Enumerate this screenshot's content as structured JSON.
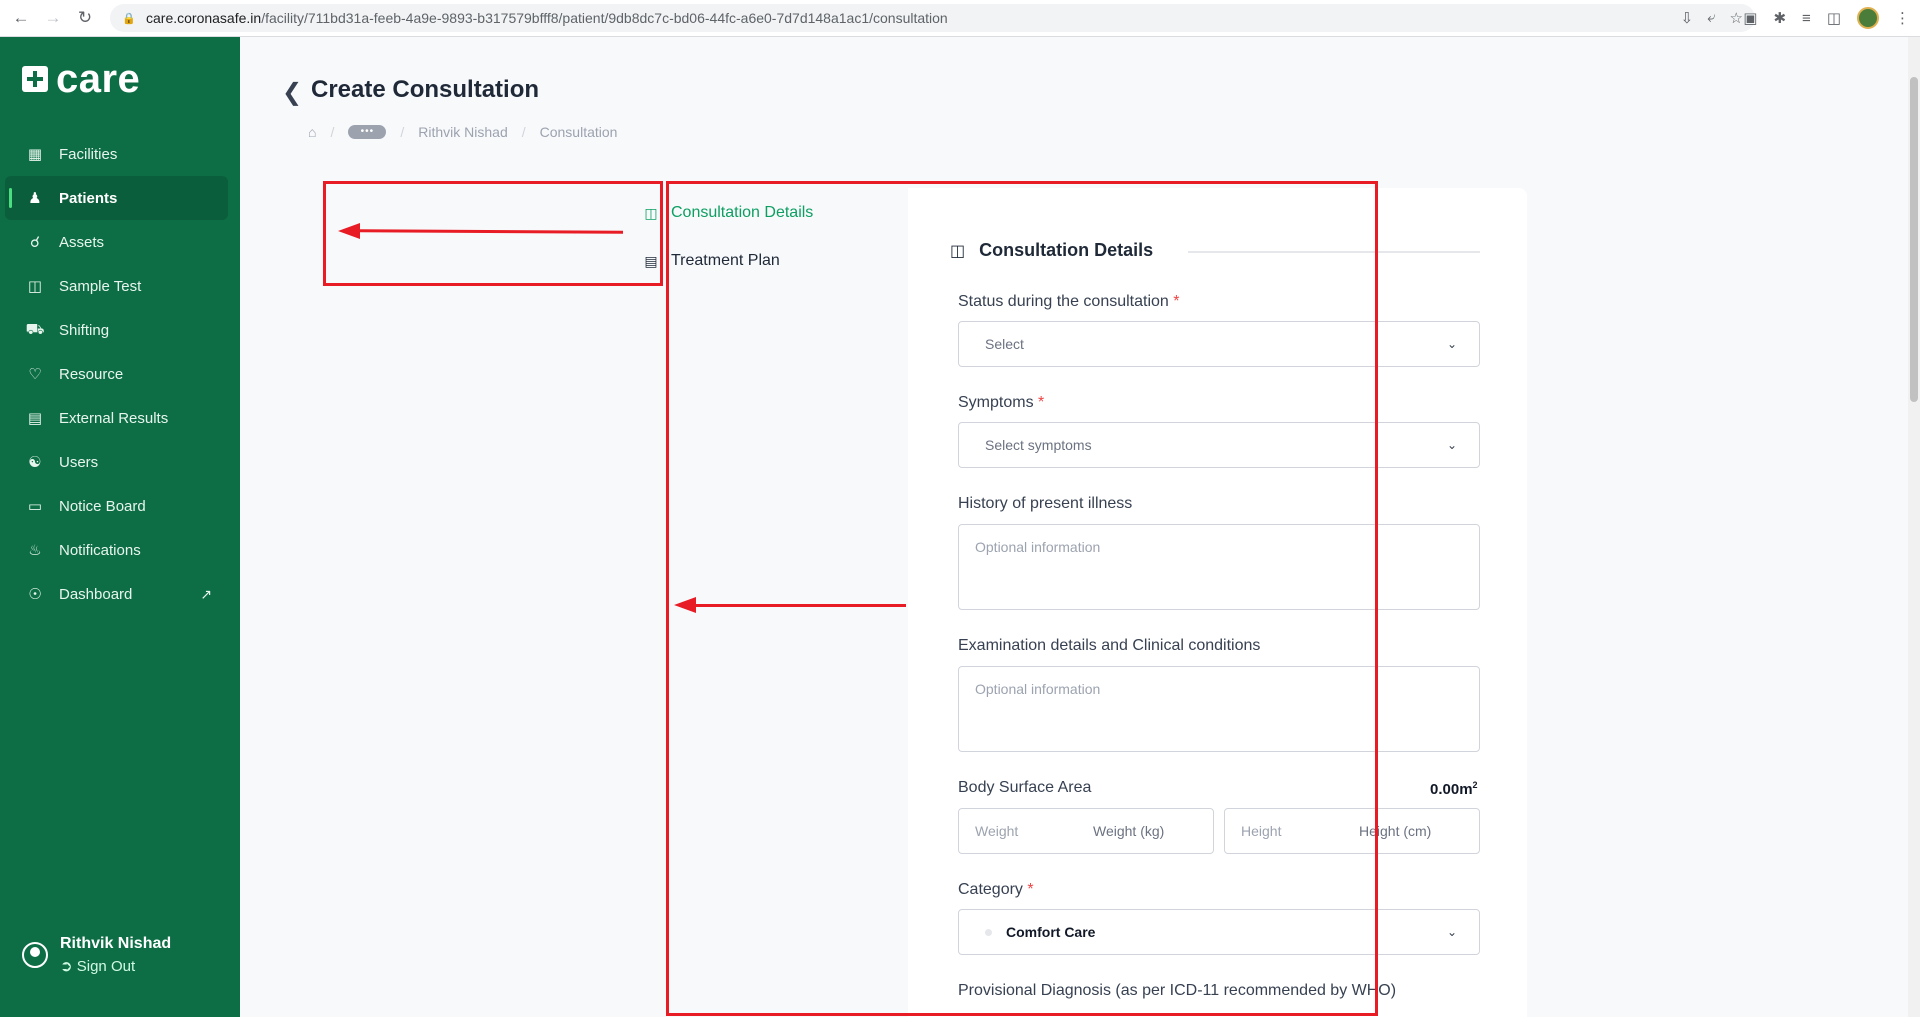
{
  "browser": {
    "url_host": "care.coronasafe.in",
    "url_path": "/facility/711bd31a-feeb-4a9e-9893-b317579bfff8/patient/9db8dc7c-bd06-44fc-a6e0-7d7d148a1ac1/consultation"
  },
  "sidebar": {
    "logo": "care",
    "items": [
      {
        "label": "Facilities",
        "icon": "building-icon"
      },
      {
        "label": "Patients",
        "icon": "user-icon"
      },
      {
        "label": "Assets",
        "icon": "cart-icon"
      },
      {
        "label": "Sample Test",
        "icon": "medkit-icon"
      },
      {
        "label": "Shifting",
        "icon": "ambulance-icon"
      },
      {
        "label": "Resource",
        "icon": "heart-icon"
      },
      {
        "label": "External Results",
        "icon": "clipboard-icon"
      },
      {
        "label": "Users",
        "icon": "users-icon"
      },
      {
        "label": "Notice Board",
        "icon": "monitor-icon"
      },
      {
        "label": "Notifications",
        "icon": "bell-icon"
      },
      {
        "label": "Dashboard",
        "icon": "dashboard-icon"
      }
    ],
    "active_item": "Patients",
    "user_name": "Rithvik Nishad",
    "sign_out": "Sign Out"
  },
  "header": {
    "title": "Create Consultation",
    "breadcrumb": [
      "Rithvik Nishad",
      "Consultation"
    ]
  },
  "tabs": {
    "consultation_details": "Consultation Details",
    "treatment_plan": "Treatment Plan"
  },
  "form": {
    "section_title": "Consultation Details",
    "status_label": "Status during the consultation",
    "status_placeholder": "Select",
    "symptoms_label": "Symptoms",
    "symptoms_placeholder": "Select symptoms",
    "history_label": "History of present illness",
    "history_placeholder": "Optional information",
    "exam_label": "Examination details and Clinical conditions",
    "exam_placeholder": "Optional information",
    "bsa_label": "Body Surface Area",
    "bsa_value": "0.00m",
    "bsa_unit_sup": "2",
    "weight_placeholder": "Weight",
    "weight_unit": "Weight (kg)",
    "height_placeholder": "Height",
    "height_unit": "Height (cm)",
    "category_label": "Category",
    "category_value": "Comfort Care",
    "diagnosis_label": "Provisional Diagnosis (as per ICD-11 recommended by WHO)",
    "required_mark": "*"
  },
  "colors": {
    "sidebar_bg": "#0d6e45",
    "accent": "#0d9f62",
    "annotation": "#e81c24"
  }
}
